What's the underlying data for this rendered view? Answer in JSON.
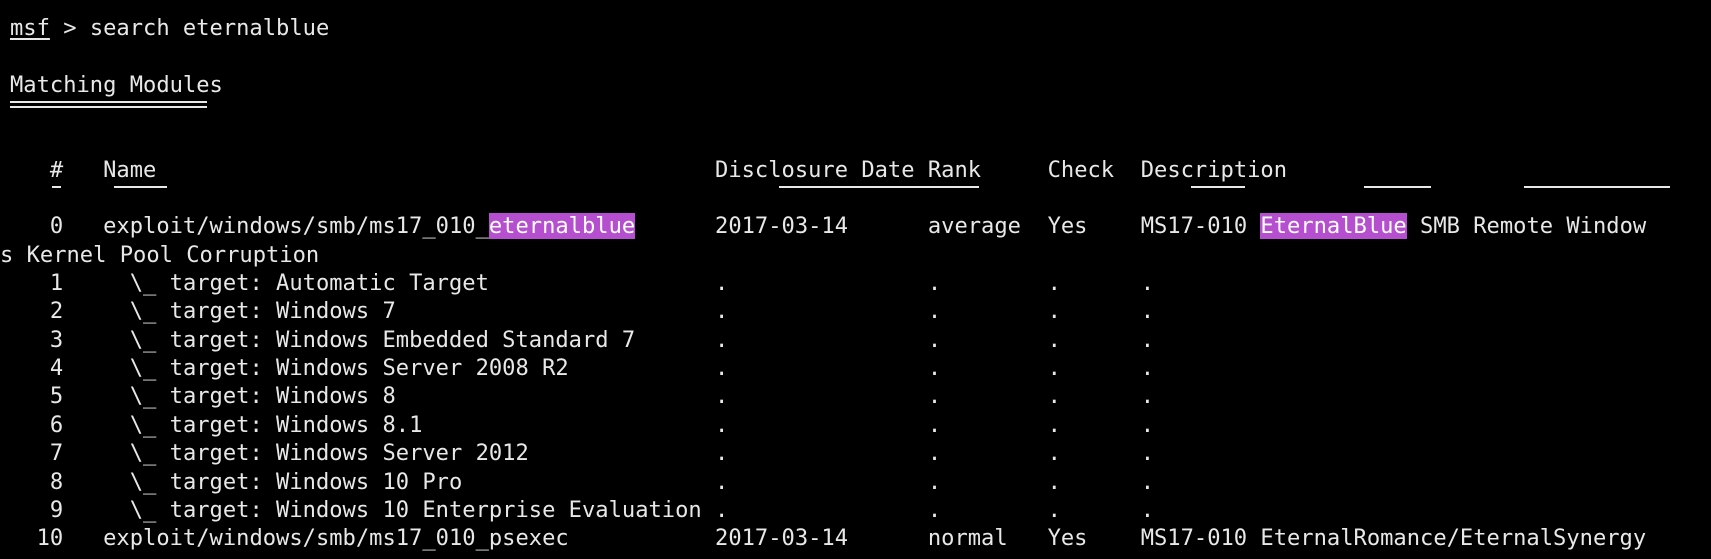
{
  "prompt": {
    "name": "msf",
    "separator": " > ",
    "command": "search eternalblue"
  },
  "section": {
    "title": "Matching Modules"
  },
  "table": {
    "headers": {
      "num": "#",
      "name": "Name",
      "date": "Disclosure Date",
      "rank": "Rank",
      "check": "Check",
      "description": "Description"
    },
    "header_underline": "-",
    "highlight_color": "#b54fd0",
    "rows": [
      {
        "num": "0",
        "name_prefix": "exploit/windows/smb/ms17_010_",
        "name_highlight": "eternalblue",
        "date": "2017-03-14",
        "rank": "average",
        "check": "Yes",
        "desc_prefix": "MS17-010 ",
        "desc_highlight": "EternalBlue",
        "desc_suffix": " SMB Remote Window",
        "wrap": "s Kernel Pool Corruption"
      },
      {
        "num": "1",
        "name": "\\_ target: Automatic Target",
        "date": ".",
        "rank": ".",
        "check": ".",
        "desc": "."
      },
      {
        "num": "2",
        "name": "\\_ target: Windows 7",
        "date": ".",
        "rank": ".",
        "check": ".",
        "desc": "."
      },
      {
        "num": "3",
        "name": "\\_ target: Windows Embedded Standard 7",
        "date": ".",
        "rank": ".",
        "check": ".",
        "desc": "."
      },
      {
        "num": "4",
        "name": "\\_ target: Windows Server 2008 R2",
        "date": ".",
        "rank": ".",
        "check": ".",
        "desc": "."
      },
      {
        "num": "5",
        "name": "\\_ target: Windows 8",
        "date": ".",
        "rank": ".",
        "check": ".",
        "desc": "."
      },
      {
        "num": "6",
        "name": "\\_ target: Windows 8.1",
        "date": ".",
        "rank": ".",
        "check": ".",
        "desc": "."
      },
      {
        "num": "7",
        "name": "\\_ target: Windows Server 2012",
        "date": ".",
        "rank": ".",
        "check": ".",
        "desc": "."
      },
      {
        "num": "8",
        "name": "\\_ target: Windows 10 Pro",
        "date": ".",
        "rank": ".",
        "check": ".",
        "desc": "."
      },
      {
        "num": "9",
        "name": "\\_ target: Windows 10 Enterprise Evaluation",
        "date": ".",
        "rank": ".",
        "check": ".",
        "desc": "."
      },
      {
        "num": "10",
        "name": "exploit/windows/smb/ms17_010_psexec",
        "date": "2017-03-14",
        "rank": "normal",
        "check": "Yes",
        "desc": "MS17-010 EternalRomance/EternalSynergy"
      }
    ]
  }
}
